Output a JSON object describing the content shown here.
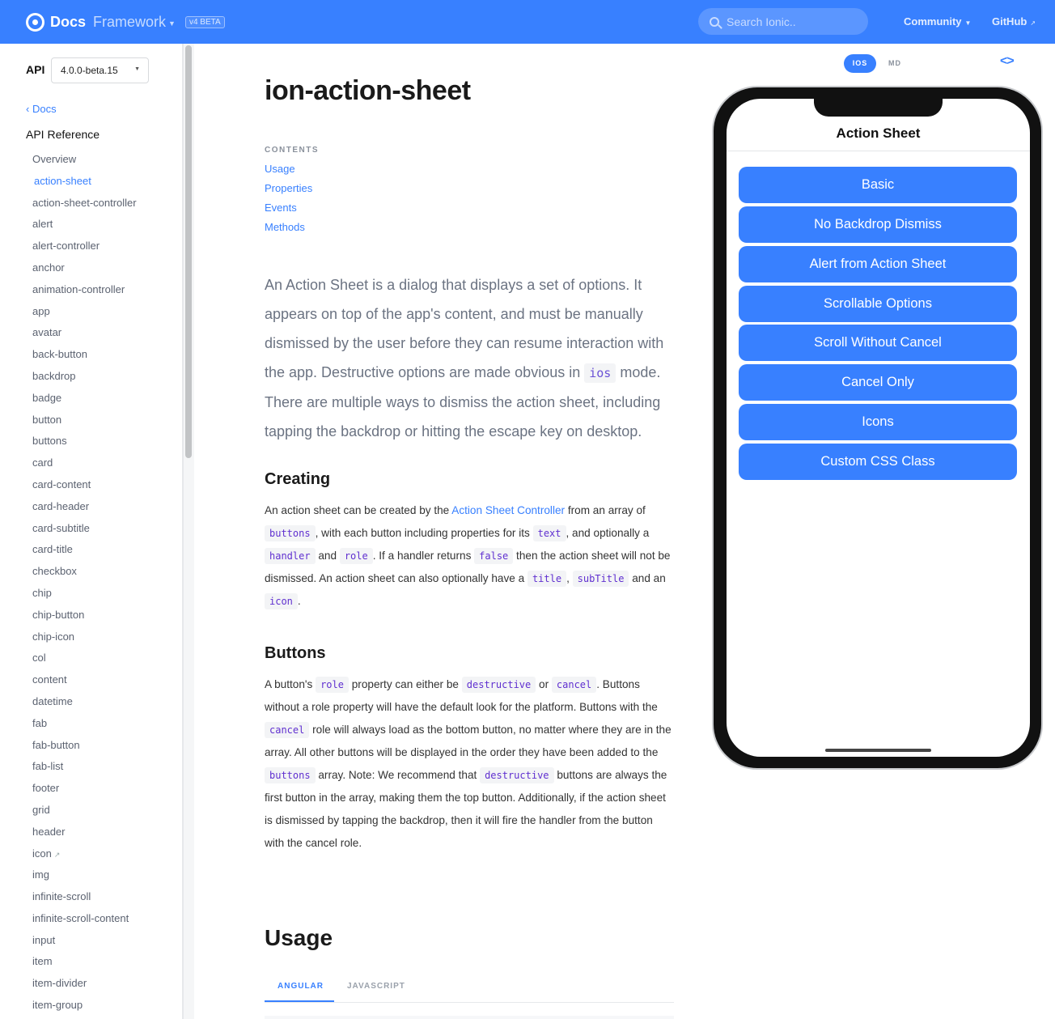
{
  "header": {
    "brand_docs": "Docs",
    "brand_framework": "Framework",
    "beta_badge": "v4 BETA",
    "search_placeholder": "Search Ionic..",
    "nav_community": "Community",
    "nav_github": "GitHub",
    "brand_color": "#3880ff"
  },
  "sidebar": {
    "api_label": "API",
    "version_selected": "4.0.0-beta.15",
    "back_link": "Docs",
    "section_title": "API Reference",
    "items": [
      "Overview",
      "action-sheet",
      "action-sheet-controller",
      "alert",
      "alert-controller",
      "anchor",
      "animation-controller",
      "app",
      "avatar",
      "back-button",
      "backdrop",
      "badge",
      "button",
      "buttons",
      "card",
      "card-content",
      "card-header",
      "card-subtitle",
      "card-title",
      "checkbox",
      "chip",
      "chip-button",
      "chip-icon",
      "col",
      "content",
      "datetime",
      "fab",
      "fab-button",
      "fab-list",
      "footer",
      "grid",
      "header",
      "icon",
      "img",
      "infinite-scroll",
      "infinite-scroll-content",
      "input",
      "item",
      "item-divider",
      "item-group"
    ],
    "active_item": "action-sheet"
  },
  "main": {
    "title": "ion-action-sheet",
    "contents_heading": "CONTENTS",
    "contents": [
      "Usage",
      "Properties",
      "Events",
      "Methods"
    ],
    "intro_a": "An Action Sheet is a dialog that displays a set of options. It appears on top of the app's content, and must be manually dismissed by the user before they can resume interaction with the app. Destructive options are made obvious in ",
    "intro_code": "ios",
    "intro_b": " mode. There are multiple ways to dismiss the action sheet, including tapping the backdrop or hitting the escape key on desktop.",
    "creating": {
      "heading": "Creating",
      "t1": "An action sheet can be created by the ",
      "link": "Action Sheet Controller",
      "t2": " from an array of ",
      "c1": "buttons",
      "t3": ", with each button including properties for its ",
      "c2": "text",
      "t4": ", and optionally a ",
      "c3": "handler",
      "t5": " and ",
      "c4": "role",
      "t6": ". If a handler returns ",
      "c5": "false",
      "t7": " then the action sheet will not be dismissed. An action sheet can also optionally have a ",
      "c6": "title",
      "t8": ", ",
      "c7": "subTitle",
      "t9": " and an ",
      "c8": "icon",
      "t10": "."
    },
    "buttons_section": {
      "heading": "Buttons",
      "t1": "A button's ",
      "c1": "role",
      "t2": " property can either be ",
      "c2": "destructive",
      "t3": " or ",
      "c3": "cancel",
      "t4": ". Buttons without a role property will have the default look for the platform. Buttons with the ",
      "c4": "cancel",
      "t5": " role will always load as the bottom button, no matter where they are in the array. All other buttons will be displayed in the order they have been added to the ",
      "c5": "buttons",
      "t6": " array. Note: We recommend that ",
      "c6": "destructive",
      "t7": " buttons are always the first button in the array, making them the top button. Additionally, if the action sheet is dismissed by tapping the backdrop, then it will fire the handler from the button with the cancel role."
    },
    "usage_title": "Usage",
    "usage_tabs": [
      "ANGULAR",
      "JAVASCRIPT"
    ],
    "active_tab": "ANGULAR"
  },
  "preview": {
    "mode_ios": "IOS",
    "mode_md": "MD",
    "code_toggle": "<>",
    "screen_title": "Action Sheet",
    "buttons": [
      "Basic",
      "No Backdrop Dismiss",
      "Alert from Action Sheet",
      "Scrollable Options",
      "Scroll Without Cancel",
      "Cancel Only",
      "Icons",
      "Custom CSS Class"
    ]
  }
}
